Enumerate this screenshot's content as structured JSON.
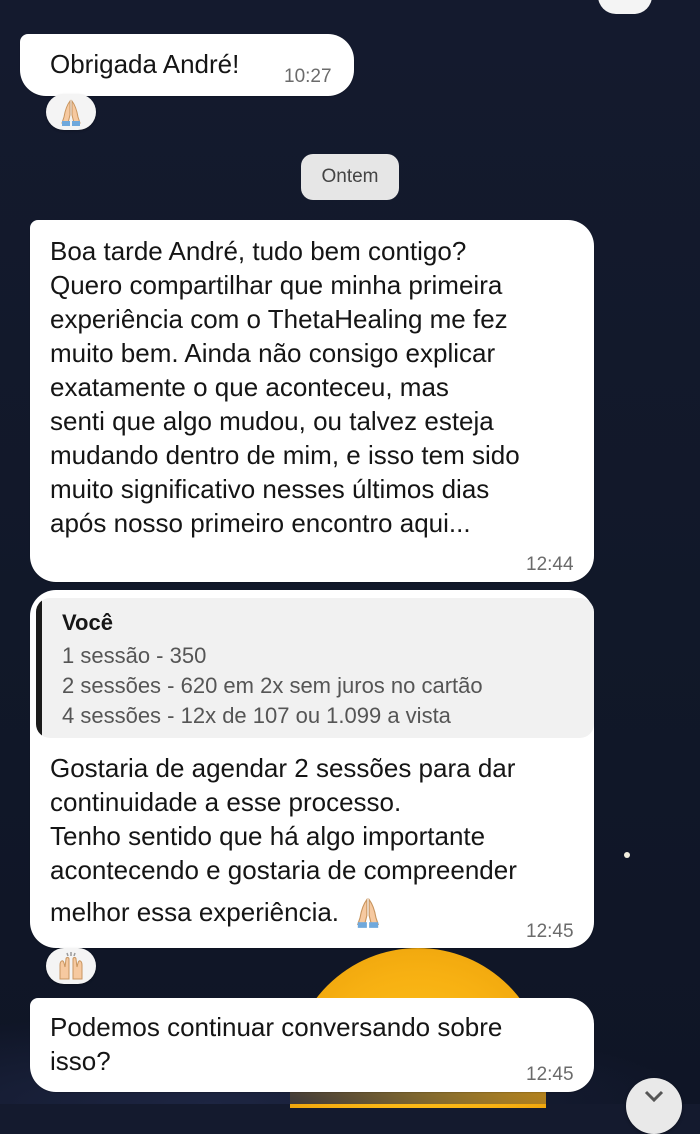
{
  "messages": [
    {
      "text": "Obrigada André!",
      "time": "10:27",
      "reaction": "folded-hands"
    },
    {
      "text": "Boa tarde André, tudo bem contigo?\nQuero compartilhar que minha primeira\nexperiência com o ThetaHealing me fez\nmuito bem. Ainda não consigo explicar\nexatamente o que aconteceu, mas\nsenti que algo mudou, ou talvez esteja\nmudando dentro de mim, e isso tem sido\nmuito significativo nesses últimos dias\napós nosso primeiro encontro aqui...",
      "time": "12:44"
    },
    {
      "quote": {
        "author": "Você",
        "lines": [
          "1 sessão - 350",
          "2 sessões - 620 em 2x sem juros no cartão",
          "4 sessões - 12x de 107 ou 1.099 a vista"
        ]
      },
      "text": "Gostaria de agendar 2 sessões para dar\ncontinuidade a esse processo.\nTenho sentido que há algo importante\nacontecendo e gostaria de compreender",
      "last_line": "melhor essa experiência.",
      "time": "12:45",
      "reaction": "raising-hands"
    },
    {
      "text": "Podemos continuar conversando sobre\nisso?",
      "time": "12:45"
    }
  ],
  "date_separator": "Ontem",
  "colors": {
    "background": "#141a2e",
    "bubble": "#ffffff",
    "sun": "#f7b012"
  }
}
